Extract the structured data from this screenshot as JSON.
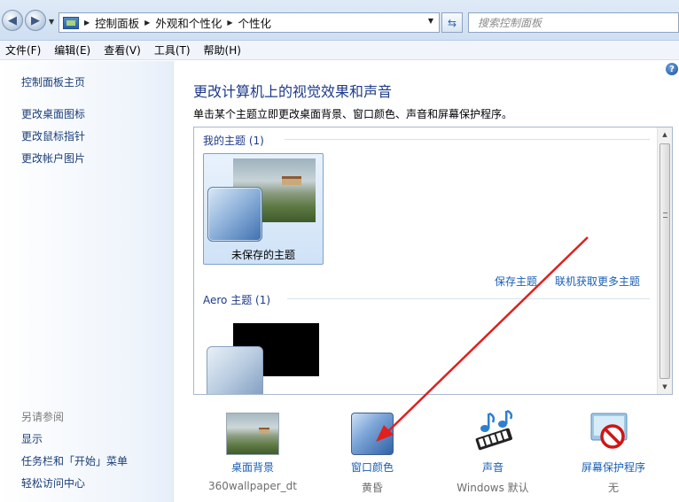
{
  "address_bar": {
    "breadcrumbs": [
      "控制面板",
      "外观和个性化",
      "个性化"
    ],
    "search_placeholder": "搜索控制面板"
  },
  "menu": [
    "文件(F)",
    "编辑(E)",
    "查看(V)",
    "工具(T)",
    "帮助(H)"
  ],
  "left_pane": {
    "home_link": "控制面板主页",
    "links": [
      "更改桌面图标",
      "更改鼠标指针",
      "更改帐户图片"
    ],
    "see_also_heading": "另请参阅",
    "see_also_links": [
      "显示",
      "任务栏和「开始」菜单",
      "轻松访问中心"
    ]
  },
  "main": {
    "title": "更改计算机上的视觉效果和声音",
    "description": "单击某个主题立即更改桌面背景、窗口颜色、声音和屏幕保护程序。",
    "my_themes_heading": "我的主题 (1)",
    "unsaved_theme_label": "未保存的主题",
    "save_theme_link": "保存主题",
    "get_more_link": "联机获取更多主题",
    "aero_heading": "Aero 主题 (1)"
  },
  "options": [
    {
      "label": "桌面背景",
      "value": "360wallpaper_dt",
      "icon": "desktop-background-icon"
    },
    {
      "label": "窗口颜色",
      "value": "黄昏",
      "icon": "window-color-icon"
    },
    {
      "label": "声音",
      "value": "Windows 默认",
      "icon": "sound-icon"
    },
    {
      "label": "屏幕保护程序",
      "value": "无",
      "icon": "screen-saver-icon"
    }
  ],
  "colors": {
    "link": "#1a5fb4",
    "title": "#1e3a8a",
    "annotation_arrow": "#e0201e"
  }
}
